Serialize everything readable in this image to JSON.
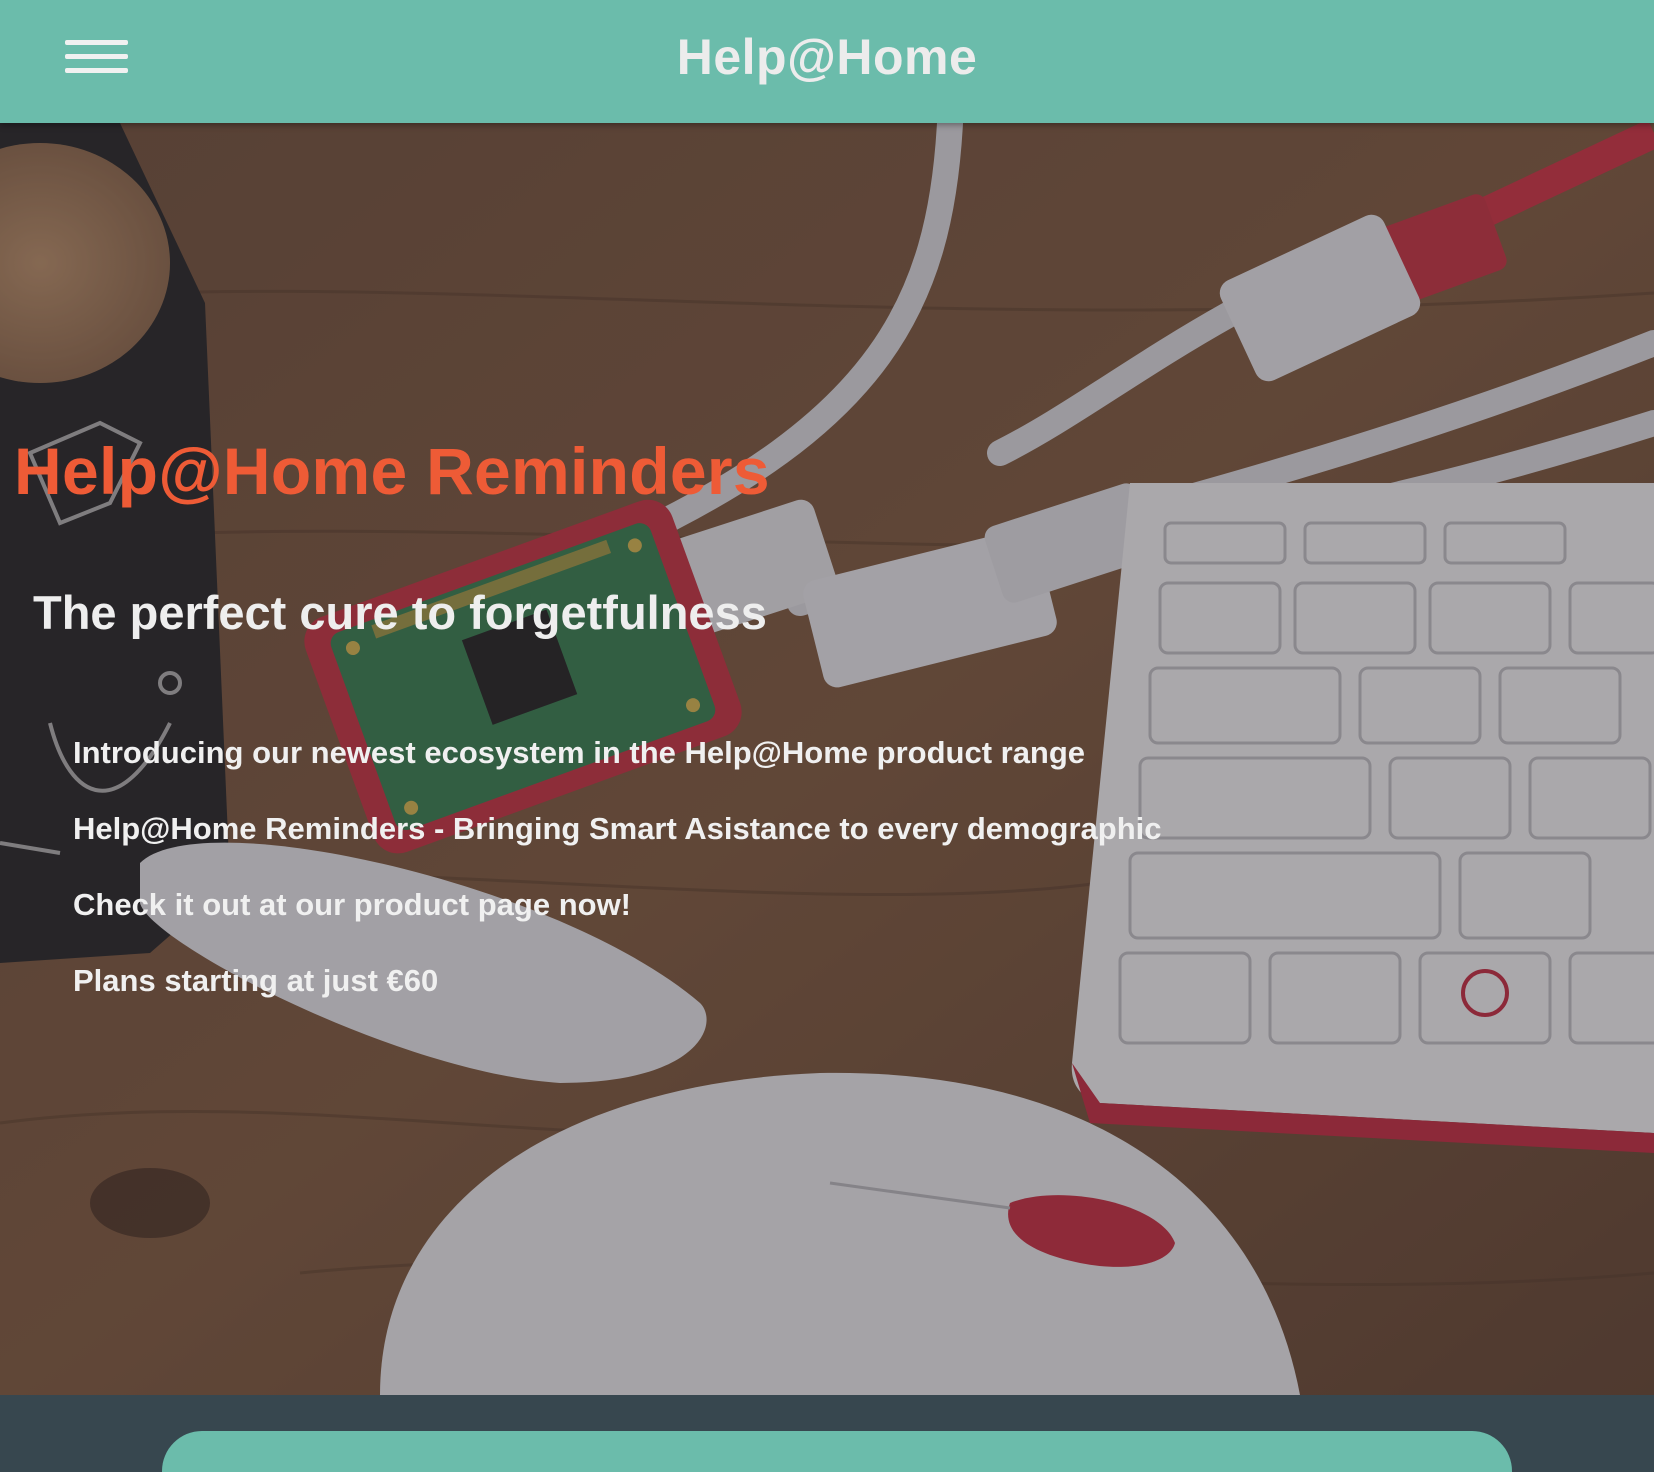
{
  "header": {
    "menu_icon": "hamburger-menu-icon",
    "brand": "Help@Home"
  },
  "hero": {
    "background": "photo: Raspberry Pi Zero in red case with cables, keyboard, mouse and mug on wooden desk",
    "title": "Help@Home Reminders",
    "subtitle": "The perfect cure to forgetfulness",
    "lines": [
      "Introducing our newest ecosystem in the Help@Home product range",
      "Help@Home Reminders - Bringing Smart Asistance to every demographic",
      "Check it out at our product page now!",
      "Plans starting at just €60"
    ]
  },
  "colors": {
    "header_bg": "#6bbcab",
    "title_accent": "#ee5b36",
    "footer_bg": "#37474f"
  }
}
